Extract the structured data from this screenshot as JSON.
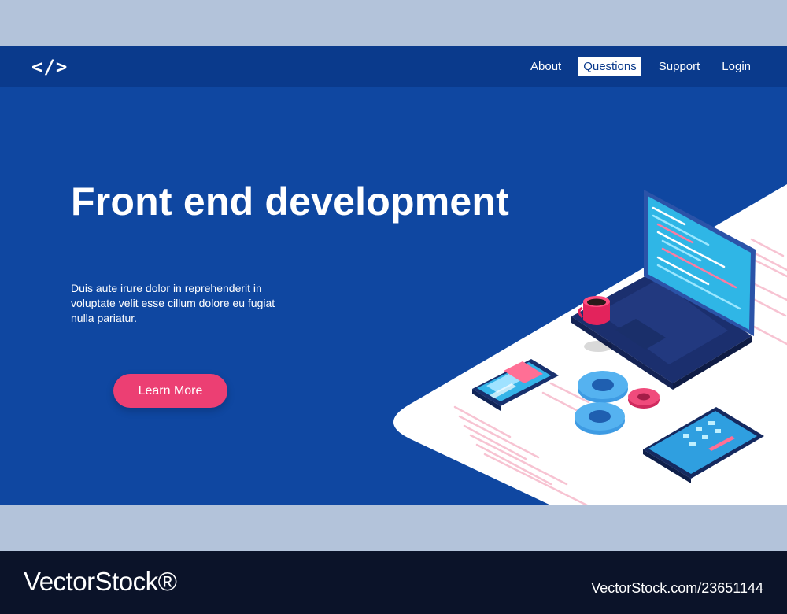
{
  "header": {
    "logo_text": "</>",
    "nav": [
      {
        "label": "About",
        "active": false
      },
      {
        "label": "Questions",
        "active": true
      },
      {
        "label": "Support",
        "active": false
      },
      {
        "label": "Login",
        "active": false
      }
    ]
  },
  "hero": {
    "title": "Front end development",
    "description": "Duis aute irure dolor in reprehenderit in voluptate velit esse  cillum dolore eu fugiat nulla pariatur.",
    "cta_label": "Learn More"
  },
  "illustration": {
    "items": [
      "laptop-icon",
      "coffee-mug-icon",
      "smartphone-icon",
      "gears-icon",
      "tablet-icon"
    ]
  },
  "watermark": {
    "brand": "VectorStock®",
    "url_id": "VectorStock.com/23651144"
  },
  "colors": {
    "background": "#b3c3da",
    "hero": "#0f47a1",
    "topbar": "#0a3a8c",
    "accent": "#ec3f73",
    "watermark_bar": "#0b1329"
  }
}
